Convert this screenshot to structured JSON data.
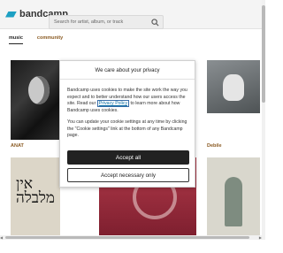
{
  "header": {
    "logo_text": "bandcamp",
    "search_placeholder": "Search for artist, album, or track"
  },
  "tabs": [
    {
      "label": "music",
      "active": true
    },
    {
      "label": "community",
      "active": false
    }
  ],
  "tiles": [
    {
      "caption": "ANAT"
    },
    {
      "caption": "Debile"
    },
    {
      "glyph_text": "אין\nמלבלה"
    }
  ],
  "cookie_modal": {
    "title": "We care about your privacy",
    "body_before_link": "Bandcamp uses cookies to make the site work the way you expect and to better understand how our users access the site. Read our ",
    "link_text": "Privacy Policy",
    "body_after_link": " to learn more about how Bandcamp uses cookies.",
    "body_2": "You can update your cookie settings at any time by clicking the \"Cookie settings\" link at the bottom of any Bandcamp page.",
    "accept_all_label": "Accept all",
    "accept_necessary_label": "Accept necessary only"
  },
  "colors": {
    "accent": "#1da0c3",
    "caption": "#8a5a22",
    "accept_button": "#222222"
  }
}
